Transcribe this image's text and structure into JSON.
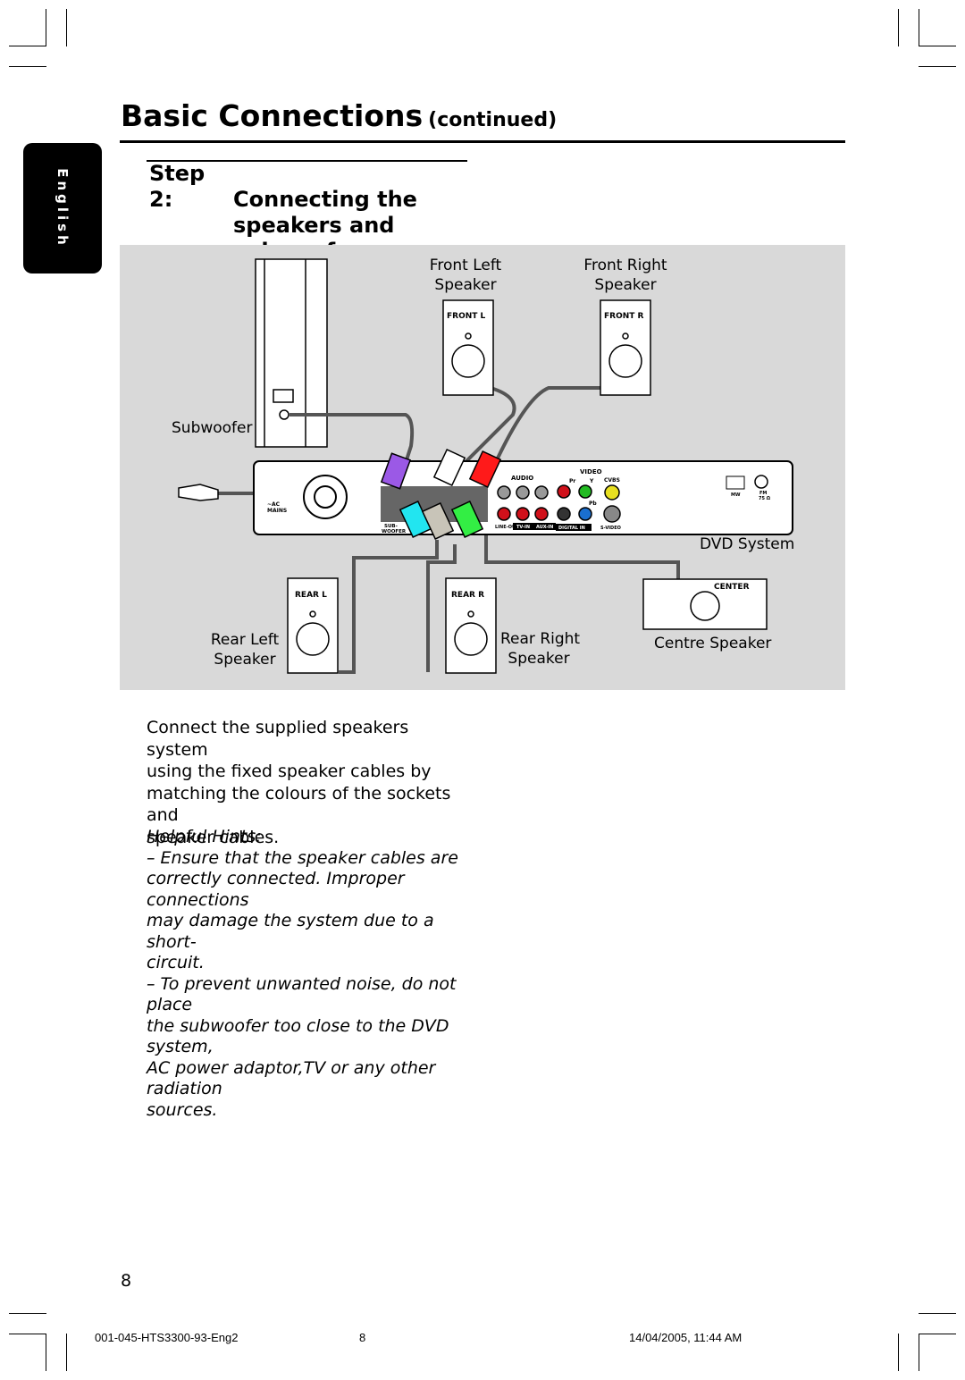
{
  "side_tab": "English",
  "header": {
    "title": "Basic Connections",
    "continued": "(continued)"
  },
  "step": {
    "number": "Step 2:",
    "lines": [
      "Connecting the",
      "speakers and",
      "subwoofer"
    ]
  },
  "diagram": {
    "labels": {
      "front_left": [
        "Front Left",
        "Speaker"
      ],
      "front_right": [
        "Front Right",
        "Speaker"
      ],
      "subwoofer": "Subwoofer",
      "dvd_system": "DVD System",
      "rear_left": [
        "Rear Left",
        "Speaker"
      ],
      "rear_right": [
        "Rear Right",
        "Speaker"
      ],
      "centre": "Centre Speaker"
    },
    "speaker_tags": {
      "front_l": "FRONT  L",
      "front_r": "FRONT  R",
      "rear_l": "REAR  L",
      "rear_r": "REAR  R",
      "center": "CENTER"
    },
    "panel": {
      "ac_mains": [
        "~AC",
        "MAINS"
      ],
      "subwoofer_out": [
        "SUB-",
        "WOOFER"
      ],
      "audio": "AUDIO",
      "video": "VIDEO",
      "pr": "Pr",
      "y": "Y",
      "pb": "Pb",
      "cvbs": "CVBS",
      "line_out": "LINE-OUT",
      "tv_in": "TV-IN",
      "aux_in": "AUX-IN",
      "digital_in": "DIGITAL IN",
      "s_video": "S-VIDEO",
      "mw": "MW",
      "fm": [
        "FM",
        "75 Ω"
      ]
    },
    "cable_colors": {
      "subwoofer": "#9b59e6",
      "front_left": "#ffffff",
      "front_right": "#ff1a1a",
      "rear_left": "#22e5f0",
      "rear_right": "#c8c4b8",
      "center": "#33ee44"
    }
  },
  "body_text": [
    "Connect the supplied speakers system",
    "using the fixed speaker cables by",
    "matching the colours of the sockets and",
    "speaker cables."
  ],
  "hints": {
    "title": "Helpful Hints:",
    "lines": [
      "–  Ensure that the speaker cables are",
      "correctly connected.  Improper connections",
      "may damage the system due to a short-",
      "circuit.",
      "–  To prevent unwanted noise, do not place",
      "the subwoofer too close to the DVD system,",
      "AC power adaptor,TV or any other radiation",
      "sources."
    ]
  },
  "page_number": "8",
  "footer": {
    "left": "001-045-HTS3300-93-Eng2",
    "center": "8",
    "right": "14/04/2005, 11:44 AM"
  }
}
